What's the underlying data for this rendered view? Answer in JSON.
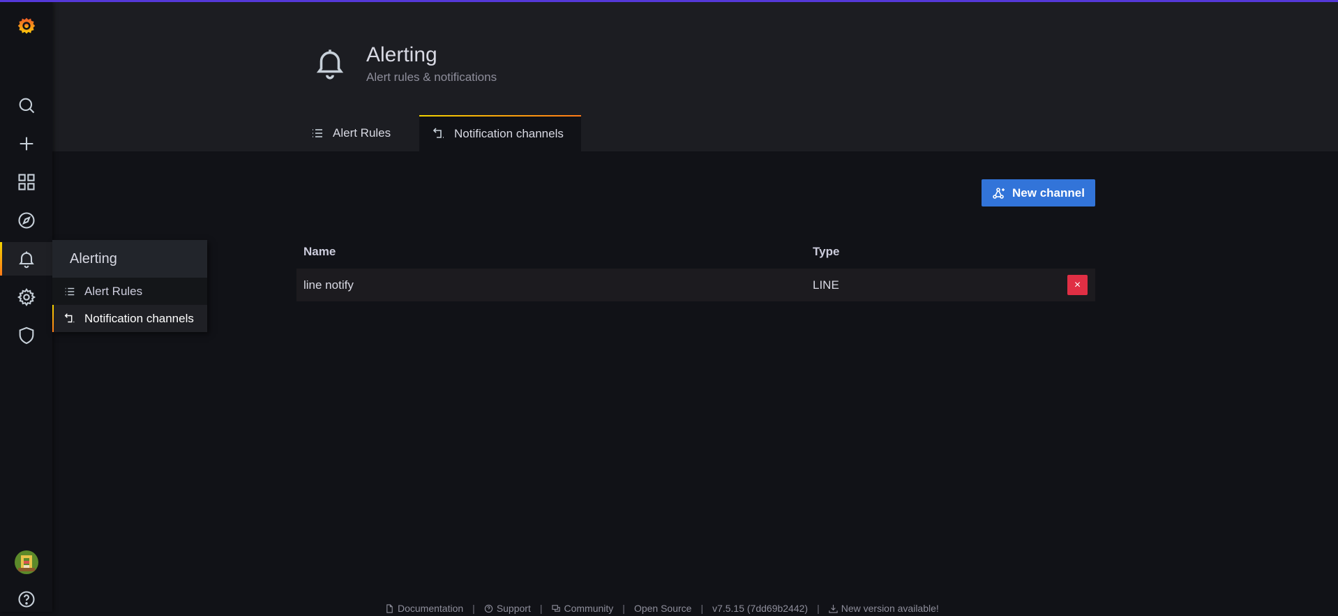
{
  "sidebar": {
    "items": [
      {
        "name": "grafana-logo-icon"
      },
      {
        "name": "search-icon"
      },
      {
        "name": "plus-icon"
      },
      {
        "name": "dashboards-icon"
      },
      {
        "name": "explore-compass-icon"
      },
      {
        "name": "bell-icon",
        "active": true
      },
      {
        "name": "gear-icon"
      },
      {
        "name": "shield-icon"
      },
      {
        "name": "user-avatar"
      },
      {
        "name": "help-icon"
      }
    ]
  },
  "header": {
    "title": "Alerting",
    "subtitle": "Alert rules & notifications",
    "icon": "bell-icon"
  },
  "tabs": [
    {
      "label": "Alert Rules",
      "icon": "list-icon",
      "active": false
    },
    {
      "label": "Notification channels",
      "icon": "notification-channel-icon",
      "active": true
    }
  ],
  "actions": {
    "new_channel_label": "New channel",
    "new_channel_icon": "share-nodes-icon"
  },
  "table": {
    "columns": [
      "Name",
      "Type"
    ],
    "rows": [
      {
        "name": "line notify",
        "type": "LINE",
        "delete_label": "×"
      }
    ]
  },
  "flyout": {
    "title": "Alerting",
    "items": [
      {
        "label": "Alert Rules",
        "icon": "list-icon",
        "active": false
      },
      {
        "label": "Notification channels",
        "icon": "notification-channel-icon",
        "active": true
      }
    ]
  },
  "footer": {
    "documentation": "Documentation",
    "support": "Support",
    "community": "Community",
    "open_source": "Open Source",
    "version": "v7.5.15 (7dd69b2442)",
    "new_version": "New version available!",
    "separator": "|"
  },
  "colors": {
    "accent_top": "#5438d8",
    "primary_button": "#3274d9",
    "danger": "#e02f44",
    "active_gradient_start": "#f4d400",
    "active_gradient_end": "#ff7a18",
    "background": "#111217",
    "panel": "#1c1d22"
  }
}
